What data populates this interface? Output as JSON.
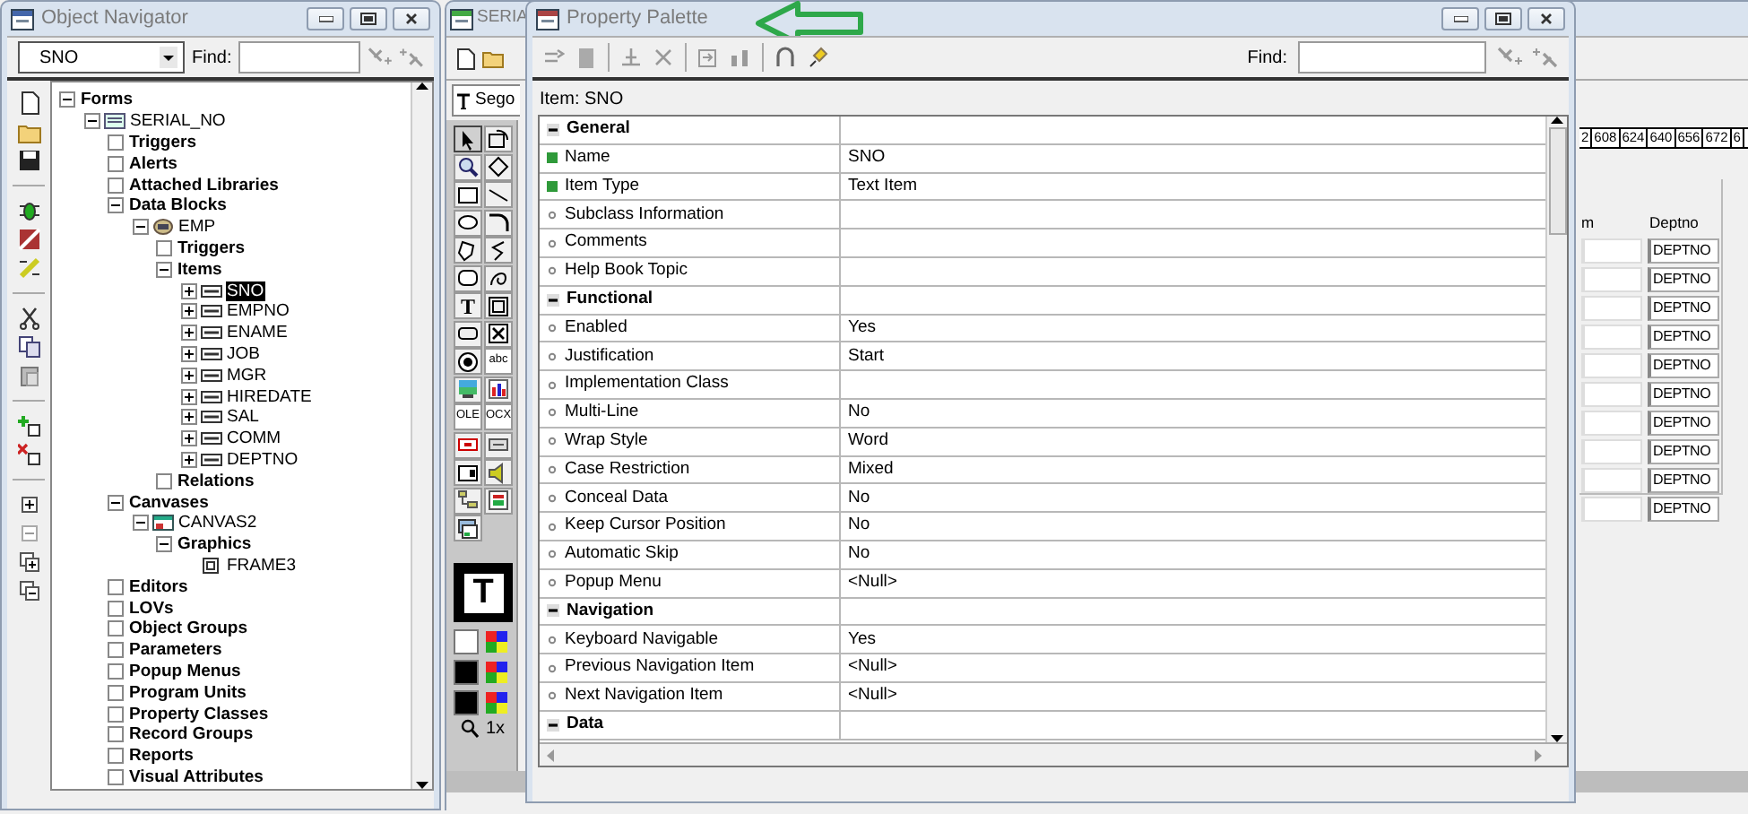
{
  "object_navigator": {
    "title": "Object Navigator",
    "context_select": "SNO",
    "find_label": "Find:",
    "tree": [
      {
        "label": "Forms",
        "kind": "category",
        "expanded": true,
        "children": [
          {
            "label": "SERIAL_NO",
            "kind": "form",
            "expanded": true,
            "children": [
              {
                "label": "Triggers",
                "kind": "category"
              },
              {
                "label": "Alerts",
                "kind": "category"
              },
              {
                "label": "Attached Libraries",
                "kind": "category"
              },
              {
                "label": "Data Blocks",
                "kind": "category",
                "expanded": true,
                "children": [
                  {
                    "label": "EMP",
                    "kind": "block",
                    "expanded": true,
                    "children": [
                      {
                        "label": "Triggers",
                        "kind": "category"
                      },
                      {
                        "label": "Items",
                        "kind": "category",
                        "expanded": true,
                        "children": [
                          {
                            "label": "SNO",
                            "kind": "item",
                            "expanded": false,
                            "selected": true
                          },
                          {
                            "label": "EMPNO",
                            "kind": "item",
                            "expanded": false,
                            "selected": false
                          },
                          {
                            "label": "ENAME",
                            "kind": "item",
                            "expanded": false,
                            "selected": false
                          },
                          {
                            "label": "JOB",
                            "kind": "item",
                            "expanded": false,
                            "selected": false
                          },
                          {
                            "label": "MGR",
                            "kind": "item",
                            "expanded": false,
                            "selected": false
                          },
                          {
                            "label": "HIREDATE",
                            "kind": "item",
                            "expanded": false,
                            "selected": false
                          },
                          {
                            "label": "SAL",
                            "kind": "item",
                            "expanded": false,
                            "selected": false
                          },
                          {
                            "label": "COMM",
                            "kind": "item",
                            "expanded": false,
                            "selected": false
                          },
                          {
                            "label": "DEPTNO",
                            "kind": "item",
                            "expanded": false,
                            "selected": false
                          }
                        ]
                      },
                      {
                        "label": "Relations",
                        "kind": "category"
                      }
                    ]
                  }
                ]
              },
              {
                "label": "Canvases",
                "kind": "category",
                "expanded": true,
                "children": [
                  {
                    "label": "CANVAS2",
                    "kind": "canvas",
                    "expanded": true,
                    "children": [
                      {
                        "label": "Graphics",
                        "kind": "category",
                        "expanded": true,
                        "children": [
                          {
                            "label": "FRAME3",
                            "kind": "graphic"
                          }
                        ]
                      }
                    ]
                  }
                ]
              },
              {
                "label": "Editors",
                "kind": "category"
              },
              {
                "label": "LOVs",
                "kind": "category"
              },
              {
                "label": "Object Groups",
                "kind": "category"
              },
              {
                "label": "Parameters",
                "kind": "category"
              },
              {
                "label": "Popup Menus",
                "kind": "category"
              },
              {
                "label": "Program Units",
                "kind": "category"
              },
              {
                "label": "Property Classes",
                "kind": "category"
              },
              {
                "label": "Record Groups",
                "kind": "category"
              },
              {
                "label": "Reports",
                "kind": "category"
              },
              {
                "label": "Visual Attributes",
                "kind": "category"
              }
            ]
          }
        ]
      }
    ]
  },
  "layout_editor": {
    "title": "SERIA",
    "font_select": "Sego",
    "zoom_label": "1x",
    "ruler_labels": [
      "2",
      "608",
      "624",
      "640",
      "656",
      "672",
      "6"
    ],
    "column_headers": [
      "m",
      "Deptno"
    ],
    "field_values": [
      "DEPTNO",
      "DEPTNO",
      "DEPTNO",
      "DEPTNO",
      "DEPTNO",
      "DEPTNO",
      "DEPTNO",
      "DEPTNO",
      "DEPTNO",
      "DEPTNO"
    ],
    "tools": [
      {
        "kind": "pointer",
        "selected": true
      },
      {
        "kind": "rotate",
        "selected": false
      },
      {
        "kind": "magnify",
        "selected": false
      },
      {
        "kind": "reshape",
        "selected": false
      },
      {
        "kind": "rectangle",
        "selected": false
      },
      {
        "kind": "line",
        "selected": false
      },
      {
        "kind": "ellipse",
        "selected": false
      },
      {
        "kind": "arc",
        "selected": false
      },
      {
        "kind": "polygon",
        "selected": false
      },
      {
        "kind": "polyline",
        "selected": false
      },
      {
        "kind": "rounded",
        "selected": false
      },
      {
        "kind": "freehand",
        "selected": false
      },
      {
        "kind": "text",
        "label": "T",
        "selected": false
      },
      {
        "kind": "frame",
        "selected": false
      },
      {
        "kind": "button",
        "selected": false
      },
      {
        "kind": "checkbox",
        "selected": false
      },
      {
        "kind": "radio",
        "selected": false
      },
      {
        "kind": "textitem",
        "label": "abc",
        "selected": false
      },
      {
        "kind": "image",
        "selected": false
      },
      {
        "kind": "chart",
        "selected": false
      },
      {
        "kind": "textitem",
        "label": "OLE",
        "selected": false
      },
      {
        "kind": "textitem",
        "label": "OCX",
        "selected": false
      },
      {
        "kind": "tab",
        "selected": false
      },
      {
        "kind": "display",
        "selected": false
      },
      {
        "kind": "list",
        "selected": false
      },
      {
        "kind": "sound",
        "selected": false
      },
      {
        "kind": "tree",
        "selected": false
      },
      {
        "kind": "bean",
        "selected": false
      },
      {
        "kind": "canvas",
        "selected": false
      }
    ],
    "text_sample": "T"
  },
  "property_palette": {
    "title": "Property Palette",
    "find_label": "Find:",
    "item_label": "Item: SNO",
    "properties": [
      {
        "kind": "section",
        "name": "General",
        "expanded": true
      },
      {
        "kind": "property",
        "name": "Name",
        "value": "SNO",
        "changed": true
      },
      {
        "kind": "property",
        "name": "Item Type",
        "value": "Text Item",
        "changed": true
      },
      {
        "kind": "property",
        "name": "Subclass Information",
        "changed": false
      },
      {
        "kind": "property",
        "name": "Comments",
        "changed": false
      },
      {
        "kind": "property",
        "name": "Help Book Topic",
        "changed": false
      },
      {
        "kind": "section",
        "name": "Functional",
        "expanded": true
      },
      {
        "kind": "property",
        "name": "Enabled",
        "value": "Yes",
        "changed": false
      },
      {
        "kind": "property",
        "name": "Justification",
        "value": "Start",
        "changed": false
      },
      {
        "kind": "property",
        "name": "Implementation Class",
        "changed": false
      },
      {
        "kind": "property",
        "name": "Multi-Line",
        "value": "No",
        "changed": false
      },
      {
        "kind": "property",
        "name": "Wrap Style",
        "value": "Word",
        "changed": false
      },
      {
        "kind": "property",
        "name": "Case Restriction",
        "value": "Mixed",
        "changed": false
      },
      {
        "kind": "property",
        "name": "Conceal Data",
        "value": "No",
        "changed": false
      },
      {
        "kind": "property",
        "name": "Keep Cursor Position",
        "value": "No",
        "changed": false
      },
      {
        "kind": "property",
        "name": "Automatic Skip",
        "value": "No",
        "changed": false
      },
      {
        "kind": "property",
        "name": "Popup Menu",
        "value": "<Null>",
        "changed": false
      },
      {
        "kind": "section",
        "name": "Navigation",
        "expanded": true
      },
      {
        "kind": "property",
        "name": "Keyboard Navigable",
        "value": "Yes",
        "changed": false
      },
      {
        "kind": "property",
        "name": "Previous Navigation Item",
        "value": "<Null>",
        "changed": false
      },
      {
        "kind": "property",
        "name": "Next Navigation Item",
        "value": "<Null>",
        "changed": false
      },
      {
        "kind": "section",
        "name": "Data",
        "expanded": true
      }
    ]
  }
}
